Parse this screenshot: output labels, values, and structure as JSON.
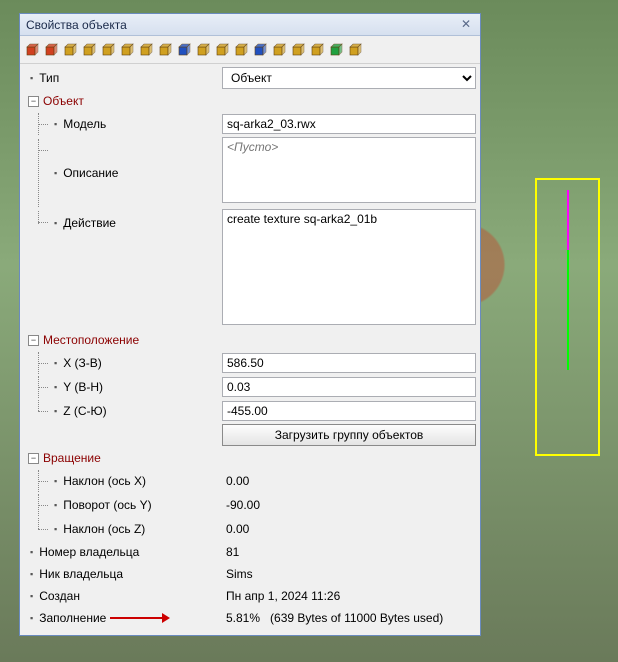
{
  "window": {
    "title": "Свойства объекта"
  },
  "type": {
    "label": "Тип",
    "value": "Объект"
  },
  "object": {
    "section_label": "Объект",
    "model": {
      "label": "Модель",
      "value": "sq-arka2_03.rwx"
    },
    "description": {
      "label": "Описание",
      "placeholder": "<Пусто>",
      "value": ""
    },
    "action": {
      "label": "Действие",
      "value": "create texture sq-arka2_01b"
    }
  },
  "location": {
    "section_label": "Местоположение",
    "x": {
      "label": "X (З-В)",
      "value": "586.50"
    },
    "y": {
      "label": "Y (В-Н)",
      "value": "0.03"
    },
    "z": {
      "label": "Z (С-Ю)",
      "value": "-455.00"
    },
    "load_group_btn": "Загрузить группу объектов"
  },
  "rotation": {
    "section_label": "Вращение",
    "tilt_x": {
      "label": "Наклон (ось X)",
      "value": "0.00"
    },
    "turn_y": {
      "label": "Поворот (ось Y)",
      "value": "-90.00"
    },
    "tilt_z": {
      "label": "Наклон (ось Z)",
      "value": "0.00"
    }
  },
  "owner_number": {
    "label": "Номер владельца",
    "value": "81"
  },
  "owner_nick": {
    "label": "Ник владельца",
    "value": "Sims"
  },
  "created": {
    "label": "Создан",
    "value": "Пн апр 1, 2024 11:26"
  },
  "fill": {
    "label": "Заполнение",
    "percent": "5.81%",
    "detail": "(639 Bytes of 11000 Bytes used)"
  },
  "toolbar_icons": [
    {
      "name": "cube-red",
      "color": "#d04020"
    },
    {
      "name": "cube-cross",
      "color": "#d04020"
    },
    {
      "name": "cube-yellow",
      "color": "#d0a020"
    },
    {
      "name": "cube-small-1",
      "color": "#d0a020"
    },
    {
      "name": "cube-small-2",
      "color": "#d0a020"
    },
    {
      "name": "cube-small-3",
      "color": "#d0a020"
    },
    {
      "name": "cube-small-4",
      "color": "#d0a020"
    },
    {
      "name": "cube-small-5",
      "color": "#d0a020"
    },
    {
      "name": "anchor",
      "color": "#2050c0"
    },
    {
      "name": "axis-1",
      "color": "#d0a020"
    },
    {
      "name": "axis-2",
      "color": "#d0a020"
    },
    {
      "name": "axis-3",
      "color": "#d0a020"
    },
    {
      "name": "axis-4",
      "color": "#2050c0"
    },
    {
      "name": "axis-5",
      "color": "#d0a020"
    },
    {
      "name": "axis-6",
      "color": "#d0a020"
    },
    {
      "name": "grid",
      "color": "#d0a020"
    },
    {
      "name": "shape-green",
      "color": "#20a040"
    },
    {
      "name": "cube-alt",
      "color": "#d0a020"
    }
  ]
}
